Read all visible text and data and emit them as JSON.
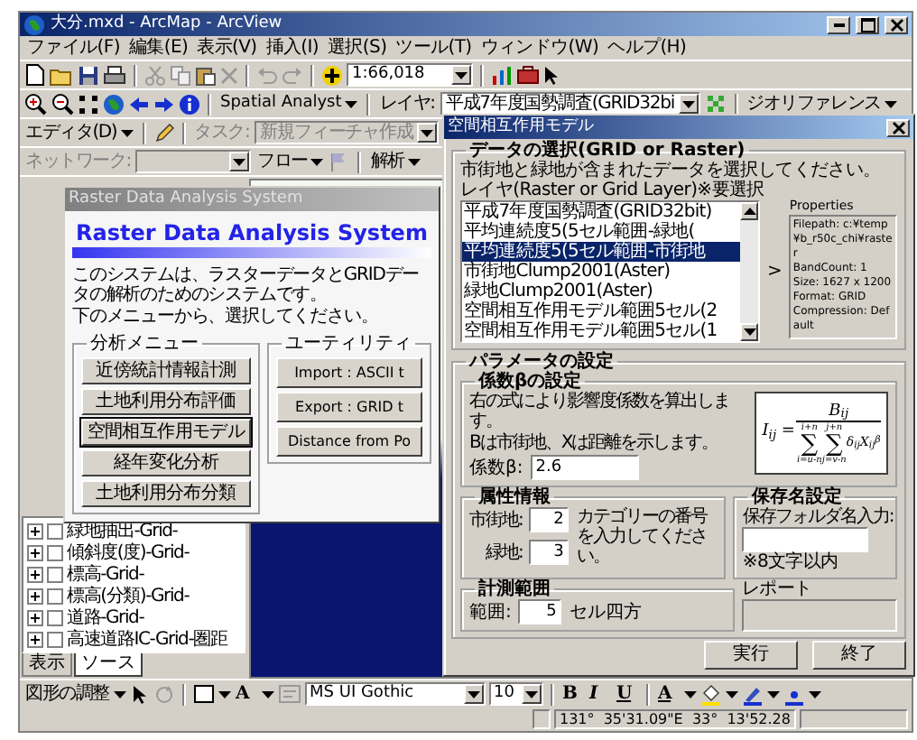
{
  "app": {
    "title": "大分.mxd - ArcMap - ArcView"
  },
  "menu": [
    "ファイル(F)",
    "編集(E)",
    "表示(V)",
    "挿入(I)",
    "選択(S)",
    "ツール(T)",
    "ウィンドウ(W)",
    "ヘルプ(H)"
  ],
  "standard_toolbar": {
    "scale": "1:66,018"
  },
  "tools_toolbar": {
    "spatial_analyst": "Spatial Analyst",
    "layer_label": "レイヤ:",
    "layer_value": "平成7年度国勢調査(GRID32bi",
    "georeferencing": "ジオリファレンス"
  },
  "editor_toolbar": {
    "editor": "エディタ(D)",
    "task_label": "タスク:",
    "task_value": "新規フィーチャ作成",
    "disabled": true
  },
  "network_toolbar": {
    "network_label": "ネットワーク:",
    "flow": "フロー",
    "analysis": "解析",
    "disabled": true
  },
  "toc": {
    "layers": [
      {
        "name": "緑地抽出-Grid-",
        "checked": false,
        "expanded": false
      },
      {
        "name": "傾斜度(度)-Grid-",
        "checked": false,
        "expanded": false
      },
      {
        "name": "標高-Grid-",
        "checked": false,
        "expanded": false
      },
      {
        "name": "標高(分類)-Grid-",
        "checked": false,
        "expanded": false
      },
      {
        "name": "道路-Grid-",
        "checked": false,
        "expanded": false
      },
      {
        "name": "高速道路IC-Grid-圏距",
        "checked": false,
        "expanded": false
      }
    ],
    "tabs": [
      {
        "label": "表示",
        "selected": false
      },
      {
        "label": "ソース",
        "selected": true
      }
    ]
  },
  "raster_window": {
    "title": "Raster Data Analysis System",
    "heading": "Raster Data Analysis System",
    "description": [
      "このシステムは、ラスターデータとGRIDデータの解析のためのシステムです。",
      "下のメニューから、選択してください。"
    ],
    "analysis_menu": {
      "title": "分析メニュー",
      "buttons": [
        {
          "label": "近傍統計情報計測",
          "focused": false
        },
        {
          "label": "土地利用分布評価",
          "focused": false
        },
        {
          "label": "空間相互作用モデル",
          "focused": true
        },
        {
          "label": "経年変化分析",
          "focused": false
        },
        {
          "label": "土地利用分布分類",
          "focused": false
        }
      ]
    },
    "utility": {
      "title": "ユーティリティ",
      "buttons": [
        "Import : ASCII t",
        "Export : GRID t",
        "Distance from Po"
      ]
    }
  },
  "dialog": {
    "title": "空間相互作用モデル",
    "data_selection": {
      "title": "データの選択(GRID or Raster)",
      "instruction": "市街地と緑地が含まれたデータを選択してください。",
      "layer_label": "レイヤ(Raster or Grid Layer)※要選択",
      "layers": [
        {
          "name": "平成7年度国勢調査(GRID32bit)",
          "selected": false
        },
        {
          "name": "平均連続度5(5セル範囲-緑地(",
          "selected": false
        },
        {
          "name": "平均連続度5(5セル範囲-市街地",
          "selected": true
        },
        {
          "name": "市街地Clump2001(Aster)",
          "selected": false
        },
        {
          "name": "緑地Clump2001(Aster)",
          "selected": false
        },
        {
          "name": "空間相互作用モデル範囲5セル(2",
          "selected": false
        },
        {
          "name": "空間相互作用モデル範囲5セル(1",
          "selected": false
        }
      ],
      "arrow": ">",
      "properties_label": "Properties",
      "properties": [
        "Filepath: c:¥temp¥b_r50c_chi¥raster",
        "BandCount: 1",
        "Size: 1627 x 1200",
        "Format: GRID",
        "Compression: Default"
      ]
    },
    "parameters": {
      "title": "パラメータの設定",
      "beta": {
        "title": "係数βの設定",
        "description": [
          "右の式により影響度係数を算出します。",
          "Bは市街地、Xは距離を示します。"
        ],
        "label": "係数β:",
        "value": "2.6",
        "formula": {
          "lhs": "I$_{ij}$ =",
          "numerator": "B$_{ij}$",
          "sums": [
            {
              "upper": "i+n",
              "symbol": "∑",
              "lower": "i=u-n"
            },
            {
              "upper": "j+n",
              "symbol": "∑",
              "lower": "j=v-n"
            }
          ],
          "term": "δ$_{ij}$X$_{ij}$$^{β}$"
        }
      },
      "attributes": {
        "title": "属性情報",
        "fields": [
          {
            "label": "市街地:",
            "value": "2"
          },
          {
            "label": "緑地:",
            "value": "3"
          }
        ],
        "note": "カテゴリーの番号を入力してください。"
      },
      "save": {
        "title": "保存名設定",
        "label": "保存フォルダ名入力:",
        "note": "※8文字以内"
      },
      "range": {
        "title": "計測範囲",
        "label": "範囲:",
        "value": "5",
        "unit": "セル四方"
      },
      "report": {
        "title": "レポート"
      }
    },
    "buttons": [
      "実行",
      "終了"
    ]
  },
  "drawing_toolbar": {
    "arrange": "図形の調整",
    "text_tool": "A",
    "font": "MS UI Gothic",
    "size": "10",
    "bold": "B",
    "italic": "I",
    "underline": "U",
    "font_color": "A"
  },
  "status_bar": {
    "coordinates": "131°  35'31.09\"E  33°  13'52.28"
  }
}
